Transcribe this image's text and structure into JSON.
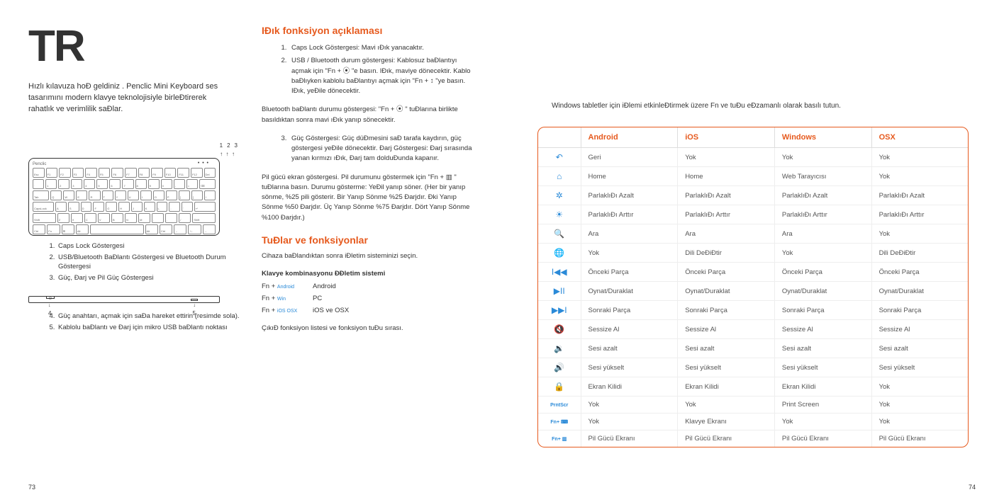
{
  "lang_code": "TR",
  "intro": "Hızlı kılavuza hoĐ geldiniz .\nPenclic Mini Keyboard ses tasarımını modern klavye teknolojisiyle birleĐtirerek rahatlık ve verimlilik saĐlar.",
  "kbd_brand": "Penclic",
  "led_labels": [
    "1",
    "2",
    "3"
  ],
  "kbd_legend": [
    "Caps Lock Göstergesi",
    "USB/Bluetooth BaĐlantı Göstergesi ve Bluetooth Durum Göstergesi",
    "Güç, Đarj ve Pil Güç Göstergesi"
  ],
  "side_labels": {
    "l": "4",
    "r": "5"
  },
  "side_legend": [
    "Güç anahtarı, açmak için saĐa hareket ettirin (resimde sola).",
    "Kablolu baĐlantı ve Đarj için mikro USB baĐlantı noktası"
  ],
  "page_left_num": "73",
  "page_right_num": "74",
  "section1_title": "IĐık fonksiyon açıklaması",
  "section1_items": [
    "Caps Lock Göstergesi: Mavi ıĐık yanacaktır.",
    "USB / Bluetooth durum göstergesi: Kablosuz baĐlantıyı açmak için \"Fn +  ⦿  \"e basın. IĐık, maviye dönecektir. Kablo baĐlıyken kablolu baĐlantıyı açmak için \"Fn +  ↕  \"ye basın. IĐık, yeĐile dönecektir."
  ],
  "section1_p1": "Bluetooth baĐlantı durumu göstergesi: \"Fn +  ⦿ \" tuĐlarına birlikte basıldıktan sonra mavi ıĐık yanıp sönecektir.",
  "section1_items_cont": [
    "Güç Göstergesi: Güç düĐmesini saĐ tarafa kaydırın, güç göstergesi yeĐile dönecektir. Đarj Göstergesi: Đarj sırasında yanan kırmızı ıĐık, Đarj tam dolduĐunda kapanır."
  ],
  "section1_p2": "Pil gücü ekran göstergesi. Pil durumunu göstermek için \"Fn +  ▥ \" tuĐlarına basın. Durumu gösterme: YeĐil yanıp söner. (Her bir yanıp sönme, %25 pili gösterir. Bir Yanıp Sönme %25 Đarjdır. Đki Yanıp Sönme %50 Đarjdır. Üç Yanıp Sönme %75 Đarjdır. Dört Yanıp Sönme %100 Đarjdır.)",
  "section2_title": "TuĐlar ve fonksiyonlar",
  "section2_p": "Cihaza baĐlandıktan sonra iĐletim sisteminizi seçin.",
  "combo_heading": "Klavye kombinasyonu ĐĐletim sistemi",
  "combos": [
    {
      "fn": "Fn + ",
      "chip": "Android",
      "os": "Android"
    },
    {
      "fn": "Fn + ",
      "chip": "Win",
      "os": "PC"
    },
    {
      "fn": "Fn + ",
      "chip": "iOS OSX",
      "os": "iOS ve OSX"
    }
  ],
  "section2_tail": "ÇıkıĐ fonksiyon listesi ve fonksiyon tuĐu sırası.",
  "table_note": "Windows tabletler için iĐlemi etkinleĐtirmek üzere Fn ve tuĐu eĐzamanlı olarak basılı tutun.",
  "table_headers": [
    "",
    "Android",
    "iOS",
    "Windows",
    "OSX"
  ],
  "table_rows": [
    {
      "icon_name": "back-icon",
      "glyph": "↶",
      "cells": [
        "Geri",
        "Yok",
        "Yok",
        "Yok"
      ]
    },
    {
      "icon_name": "home-icon",
      "glyph": "⌂",
      "cells": [
        "Home",
        "Home",
        "Web Tarayıcısı",
        "Yok"
      ]
    },
    {
      "icon_name": "brightness-down-icon",
      "glyph": "✲",
      "cells": [
        "ParlaklıĐı Azalt",
        "ParlaklıĐı Azalt",
        "ParlaklıĐı Azalt",
        "ParlaklıĐı Azalt"
      ]
    },
    {
      "icon_name": "brightness-up-icon",
      "glyph": "☀",
      "cells": [
        "ParlaklıĐı Arttır",
        "ParlaklıĐı Arttır",
        "ParlaklıĐı Arttır",
        "ParlaklıĐı Arttır"
      ]
    },
    {
      "icon_name": "search-icon",
      "glyph": "🔍",
      "cells": [
        "Ara",
        "Ara",
        "Ara",
        "Yok"
      ]
    },
    {
      "icon_name": "globe-icon",
      "glyph": "🌐",
      "cells": [
        "Yok",
        "Dili DeĐiĐtir",
        "Yok",
        "Dili DeĐiĐtir"
      ]
    },
    {
      "icon_name": "prev-track-icon",
      "glyph": "I◀◀",
      "cells": [
        "Önceki Parça",
        "Önceki Parça",
        "Önceki Parça",
        "Önceki Parça"
      ]
    },
    {
      "icon_name": "play-pause-icon",
      "glyph": "▶II",
      "cells": [
        "Oynat/Duraklat",
        "Oynat/Duraklat",
        "Oynat/Duraklat",
        "Oynat/Duraklat"
      ]
    },
    {
      "icon_name": "next-track-icon",
      "glyph": "▶▶I",
      "cells": [
        "Sonraki Parça",
        "Sonraki Parça",
        "Sonraki Parça",
        "Sonraki Parça"
      ]
    },
    {
      "icon_name": "mute-icon",
      "glyph": "🔇",
      "cells": [
        "Sessize Al",
        "Sessize Al",
        "Sessize Al",
        "Sessize Al"
      ]
    },
    {
      "icon_name": "vol-down-icon",
      "glyph": "🔉",
      "cells": [
        "Sesi azalt",
        "Sesi azalt",
        "Sesi azalt",
        "Sesi azalt"
      ]
    },
    {
      "icon_name": "vol-up-icon",
      "glyph": "🔊",
      "cells": [
        "Sesi yükselt",
        "Sesi yükselt",
        "Sesi yükselt",
        "Sesi yükselt"
      ]
    },
    {
      "icon_name": "lock-icon",
      "glyph": "🔒",
      "cells": [
        "Ekran Kilidi",
        "Ekran Kilidi",
        "Ekran Kilidi",
        "Yok"
      ]
    },
    {
      "icon_name": "print-screen-icon",
      "glyph": "PrntScr",
      "text": true,
      "cells": [
        "Yok",
        "Yok",
        "Print Screen",
        "Yok"
      ]
    },
    {
      "icon_name": "keyboard-screen-icon",
      "glyph": "Fn+ ⌨",
      "text": true,
      "cells": [
        "Yok",
        "Klavye Ekranı",
        "Yok",
        "Yok"
      ]
    },
    {
      "icon_name": "battery-screen-icon",
      "glyph": "Fn+ ▥",
      "text": true,
      "cells": [
        "Pil Gücü Ekranı",
        "Pil Gücü Ekranı",
        "Pil Gücü Ekranı",
        "Pil Gücü Ekranı"
      ]
    }
  ]
}
